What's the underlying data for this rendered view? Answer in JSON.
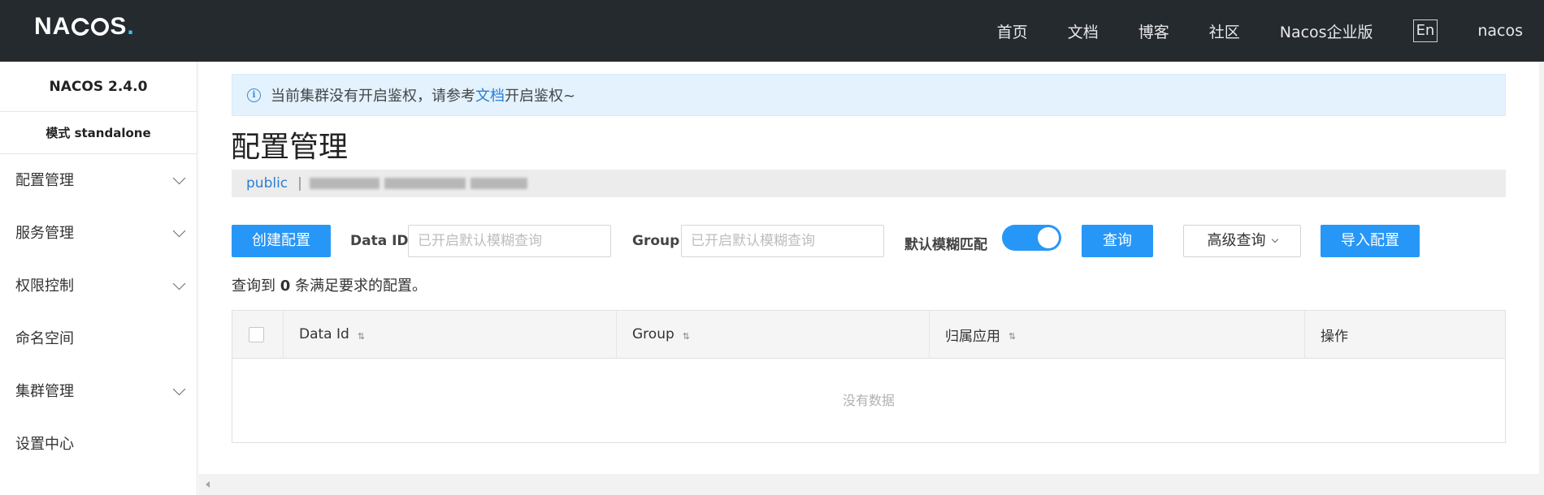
{
  "header": {
    "logo_text": "NACOS.",
    "nav": [
      "首页",
      "文档",
      "博客",
      "社区",
      "Nacos企业版"
    ],
    "lang": "En",
    "user": "nacos"
  },
  "sidebar": {
    "version": "NACOS 2.4.0",
    "mode": "模式 standalone",
    "items": [
      {
        "label": "配置管理",
        "expandable": true
      },
      {
        "label": "服务管理",
        "expandable": true
      },
      {
        "label": "权限控制",
        "expandable": true
      },
      {
        "label": "命名空间",
        "expandable": false
      },
      {
        "label": "集群管理",
        "expandable": true
      },
      {
        "label": "设置中心",
        "expandable": false
      }
    ]
  },
  "notice": {
    "before": "当前集群没有开启鉴权，请参考",
    "link": "文档",
    "after": "开启鉴权~"
  },
  "page_title": "配置管理",
  "namespace": {
    "current": "public",
    "separator": "|"
  },
  "toolbar": {
    "create_label": "创建配置",
    "data_id_label": "Data ID",
    "data_id_placeholder": "已开启默认模糊查询",
    "group_label": "Group",
    "group_placeholder": "已开启默认模糊查询",
    "fuzzy_label": "默认模糊匹配",
    "fuzzy_on": true,
    "query_label": "查询",
    "advanced_label": "高级查询",
    "import_label": "导入配置"
  },
  "result": {
    "prefix": "查询到",
    "count": "0",
    "suffix": "条满足要求的配置。"
  },
  "table": {
    "columns": [
      "Data Id",
      "Group",
      "归属应用",
      "操作"
    ],
    "empty_text": "没有数据"
  },
  "colors": {
    "primary": "#2797f7",
    "topbar": "#252a2f",
    "link": "#2b7ed3"
  }
}
